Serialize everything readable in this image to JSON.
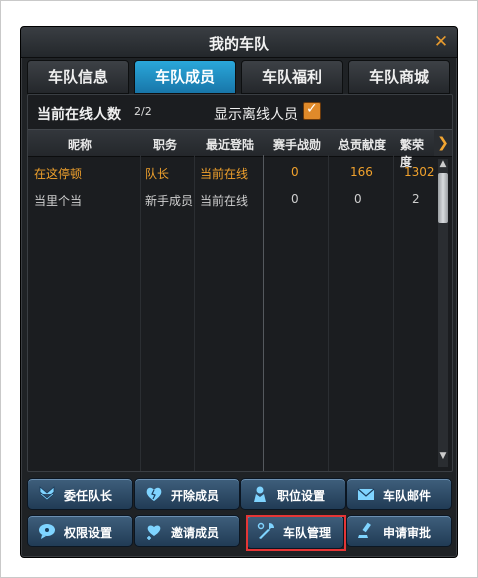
{
  "window": {
    "title": "我的车队",
    "close_glyph": "✕"
  },
  "tabs": [
    {
      "label": "车队信息",
      "active": false
    },
    {
      "label": "车队成员",
      "active": true
    },
    {
      "label": "车队福利",
      "active": false
    },
    {
      "label": "车队商城",
      "active": false
    }
  ],
  "roster": {
    "online_label": "当前在线人数",
    "online_count": "2/2",
    "show_offline_label": "显示离线人员",
    "show_offline_checked": true,
    "columns": [
      "昵称",
      "职务",
      "最近登陆",
      "赛手战勋",
      "总贡献度",
      "繁荣度"
    ],
    "rows": [
      {
        "name": "在这停顿",
        "role": "队长",
        "last_login": "当前在线",
        "merit": "0",
        "contribution": "166",
        "prosperity": "1302"
      },
      {
        "name": "当里个当",
        "role": "新手成员",
        "last_login": "当前在线",
        "merit": "0",
        "contribution": "0",
        "prosperity": "2"
      }
    ],
    "next_col_glyph": "❯",
    "scroll_up_glyph": "▲",
    "scroll_down_glyph": "▼"
  },
  "actions": [
    {
      "label": "委任队长",
      "icon": "appoint-icon"
    },
    {
      "label": "开除成员",
      "icon": "dismiss-icon"
    },
    {
      "label": "职位设置",
      "icon": "position-icon"
    },
    {
      "label": "车队邮件",
      "icon": "mail-icon"
    },
    {
      "label": "权限设置",
      "icon": "permission-icon"
    },
    {
      "label": "邀请成员",
      "icon": "invite-icon"
    },
    {
      "label": "车队管理",
      "icon": "wrench-icon"
    },
    {
      "label": "申请审批",
      "icon": "approve-icon"
    }
  ],
  "colors": {
    "accent_orange": "#f0a12c",
    "tab_active": "#1e8cc4",
    "button_blue": "#2d4a66",
    "highlight_red": "#e53636"
  }
}
